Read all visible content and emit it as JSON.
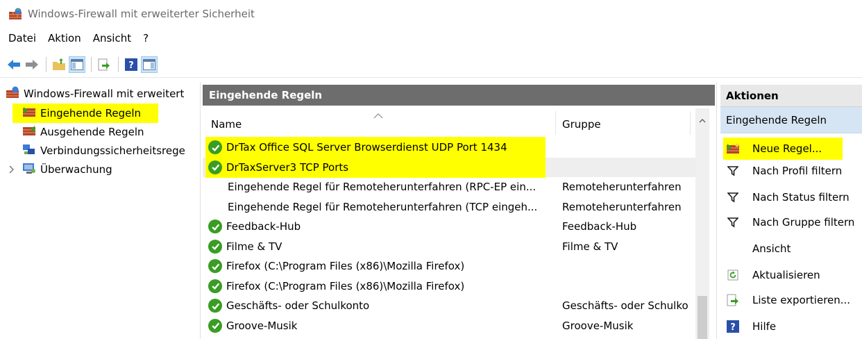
{
  "window": {
    "title": "Windows-Firewall mit erweiterter Sicherheit"
  },
  "menu": [
    "Datei",
    "Aktion",
    "Ansicht",
    "?"
  ],
  "tree": {
    "root": "Windows-Firewall mit erweitert",
    "items": [
      {
        "label": "Eingehende Regeln"
      },
      {
        "label": "Ausgehende Regeln"
      },
      {
        "label": "Verbindungssicherheitsrege"
      },
      {
        "label": "Überwachung"
      }
    ]
  },
  "center": {
    "header": "Eingehende Regeln",
    "columns": {
      "name": "Name",
      "group": "Gruppe"
    },
    "rows": [
      {
        "name": "DrTax Office SQL Server Browserdienst UDP Port 1434",
        "group": ""
      },
      {
        "name": "DrTaxServer3 TCP Ports",
        "group": ""
      },
      {
        "name": "Eingehende Regel für Remoteherunterfahren (RPC-EP ein...",
        "group": "Remoteherunterfahren"
      },
      {
        "name": "Eingehende Regel für Remoteherunterfahren (TCP eingeh...",
        "group": "Remoteherunterfahren"
      },
      {
        "name": "Feedback-Hub",
        "group": "Feedback-Hub"
      },
      {
        "name": "Filme & TV",
        "group": "Filme & TV"
      },
      {
        "name": "Firefox (C:\\Program Files (x86)\\Mozilla Firefox)",
        "group": ""
      },
      {
        "name": "Firefox (C:\\Program Files (x86)\\Mozilla Firefox)",
        "group": ""
      },
      {
        "name": "Geschäfts- oder Schulkonto",
        "group": "Geschäfts- oder Schulko"
      },
      {
        "name": "Groove-Musik",
        "group": "Groove-Musik"
      }
    ]
  },
  "actions": {
    "header": "Aktionen",
    "section": "Eingehende Regeln",
    "items": [
      {
        "label": "Neue Regel...",
        "icon": "new-rule-icon"
      },
      {
        "label": "Nach Profil filtern",
        "icon": "filter-icon"
      },
      {
        "label": "Nach Status filtern",
        "icon": "filter-icon"
      },
      {
        "label": "Nach Gruppe filtern",
        "icon": "filter-icon"
      },
      {
        "label": "Ansicht",
        "icon": ""
      },
      {
        "label": "Aktualisieren",
        "icon": "refresh-icon"
      },
      {
        "label": "Liste exportieren...",
        "icon": "export-icon"
      },
      {
        "label": "Hilfe",
        "icon": "help-icon"
      }
    ]
  },
  "colors": {
    "highlight": "#ffff00",
    "panel_header": "#6d6d6d",
    "allow_green": "#3a9d23",
    "action_section": "#d6e5f3"
  }
}
